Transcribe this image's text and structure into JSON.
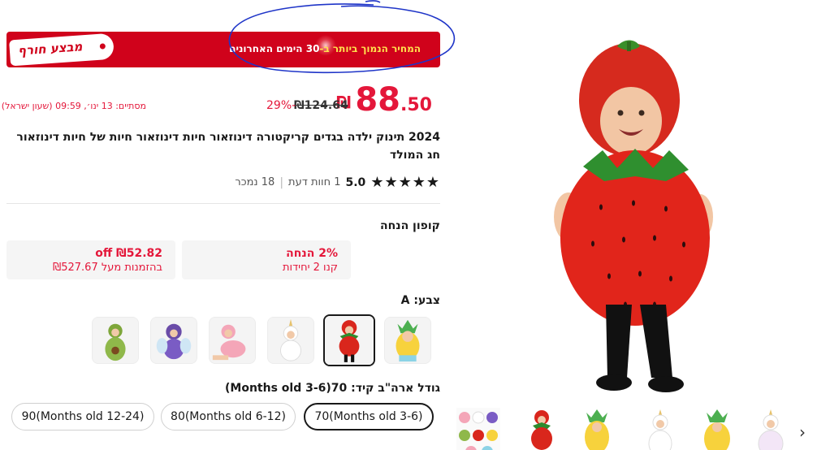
{
  "banner": {
    "badge": "מבצע חורף",
    "text_pre": "המחיר הנמוך ביותר ב-",
    "text_num": "30",
    "text_post": " הימים האחרונים"
  },
  "price": {
    "currency": "₪",
    "integer": "88",
    "decimals": ".50",
    "original": "₪124.64",
    "discount": "29%-",
    "ends": "מסתיים: 13 ינו׳, 09:59 (שעון ישראל)"
  },
  "product": {
    "title": "2024 תינוק ילדה בגדים קריקטורה דינוזאור חיות דינוזאור חיות של חיות דינוזאור חג המולד"
  },
  "rating": {
    "stars": "★★★★★",
    "value": "5.0",
    "reviews": "1 חוות דעת",
    "separator": "|",
    "sold": "18 נמכר"
  },
  "coupon": {
    "heading": "קופון הנחה",
    "items": [
      {
        "title": "2% הנחה",
        "sub": "קנו 2 יחידות"
      },
      {
        "title": "₪52.82 off",
        "sub": "בהזמנות מעל ₪527.67"
      }
    ]
  },
  "color": {
    "heading": "צבע: A",
    "options": [
      "pineapple",
      "strawberry",
      "unicorn",
      "flamingo",
      "bee",
      "avocado"
    ],
    "selected": "strawberry"
  },
  "size": {
    "heading": "גודל ארה\"ב קיד: 70(Months old 3-6)",
    "options": [
      "70(Months old 3-6)",
      "80(Months old 6-12)",
      "90(Months old 12-24)"
    ],
    "selected": "70(Months old 3-6)"
  },
  "gallery": {
    "thumbs": [
      "collage",
      "strawberry",
      "pineapple",
      "unicorn",
      "pineapple-2",
      "unicorn-2"
    ],
    "next_icon": "chevron-right-icon"
  },
  "colors": {
    "accent": "#e4173a",
    "banner": "#d0021b",
    "highlight": "#ffe14d"
  }
}
